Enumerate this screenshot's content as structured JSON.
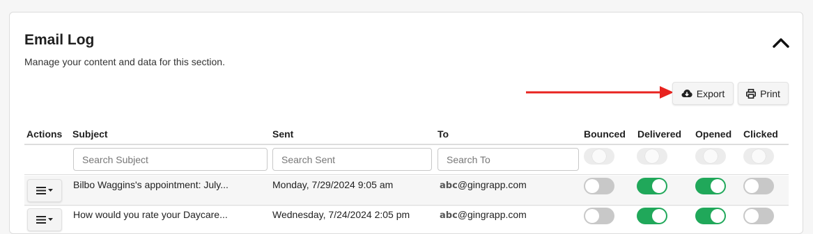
{
  "section": {
    "title": "Email Log",
    "subtitle": "Manage your content and data for this section."
  },
  "toolbar": {
    "export_label": "Export",
    "print_label": "Print"
  },
  "columns": [
    "Actions",
    "Subject",
    "Sent",
    "To",
    "Bounced",
    "Delivered",
    "Opened",
    "Clicked"
  ],
  "filters": {
    "subject_placeholder": "Search Subject",
    "sent_placeholder": "Search Sent",
    "to_placeholder": "Search To"
  },
  "rows": [
    {
      "subject": "Bilbo Waggins's appointment: July...",
      "sent": "Monday, 7/29/2024 9:05 am",
      "to_prefix": "abc",
      "to_domain": "@gingrapp.com",
      "bounced": false,
      "delivered": true,
      "opened": true,
      "clicked": false
    },
    {
      "subject": "How would you rate your Daycare...",
      "sent": "Wednesday, 7/24/2024 2:05 pm",
      "to_prefix": "abc",
      "to_domain": "@gingrapp.com",
      "bounced": false,
      "delivered": true,
      "opened": true,
      "clicked": false
    }
  ],
  "colors": {
    "toggle_on": "#20a85a",
    "toggle_off": "#c8c8c8",
    "annotation_arrow": "#e8231f"
  },
  "icons": {
    "collapse": "chevron-up-icon",
    "export": "cloud-download-icon",
    "print": "printer-icon",
    "row_actions": "hamburger-menu-icon"
  }
}
